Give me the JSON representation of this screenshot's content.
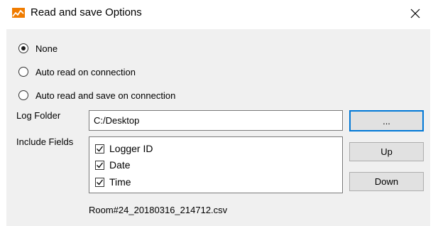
{
  "window": {
    "title": "Read and save Options",
    "icon": "chart-line-icon",
    "accent_color": "#f07c00"
  },
  "read_mode": {
    "options": [
      {
        "label": "None",
        "selected": true
      },
      {
        "label": "Auto read on connection",
        "selected": false
      },
      {
        "label": "Auto read and save on connection",
        "selected": false
      }
    ]
  },
  "log_folder": {
    "label": "Log Folder",
    "value": "C:/Desktop",
    "browse_label": "..."
  },
  "include_fields": {
    "label": "Include Fields",
    "items": [
      {
        "label": "Logger ID",
        "checked": true
      },
      {
        "label": "Date",
        "checked": true
      },
      {
        "label": "Time",
        "checked": true
      }
    ],
    "up_label": "Up",
    "down_label": "Down"
  },
  "output_filename": "Room#24_20180316_214712.csv"
}
